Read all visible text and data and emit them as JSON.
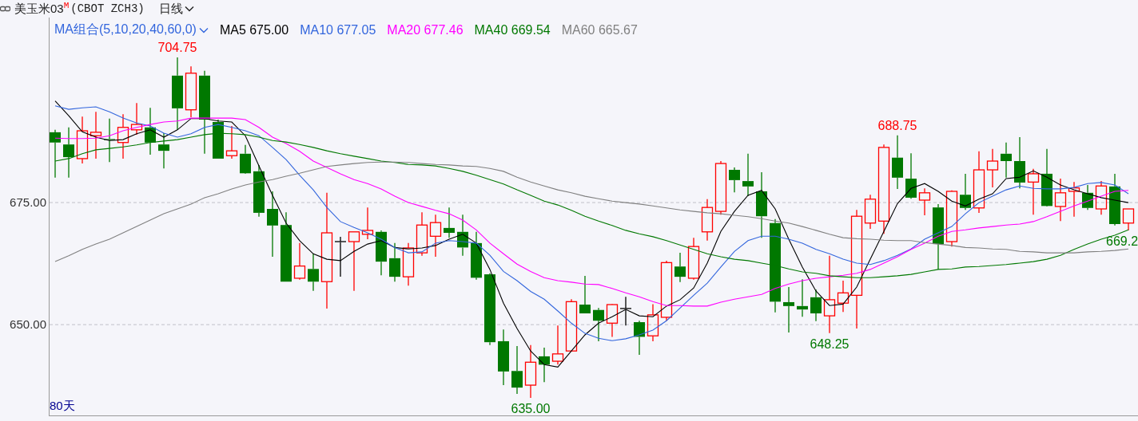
{
  "header": {
    "title": "美玉米03",
    "badge": "M",
    "code": "(CBOT ZCH3)",
    "period": "日线"
  },
  "legend": {
    "label": "MA组合(5,10,20,40,60,0)",
    "values": [
      "675.00",
      "677.05",
      "677.46",
      "669.54",
      "665.67"
    ]
  },
  "day_count": "80天",
  "chart_data": {
    "type": "candlestick",
    "ylim": [
      631.4,
      712.9
    ],
    "yticks": [
      {
        "value": 650,
        "label": "650.00"
      },
      {
        "value": 675,
        "label": "675.00"
      }
    ],
    "ohlc": [
      [
        689.4,
        689.9,
        680.1,
        687.3
      ],
      [
        686.9,
        690.4,
        680.1,
        684.3
      ],
      [
        684.0,
        692.6,
        683.0,
        689.7
      ],
      [
        688.7,
        693.6,
        684.0,
        689.4
      ],
      [
        688.0,
        692.2,
        683.3,
        687.8
      ],
      [
        687.3,
        693.1,
        684.0,
        690.4
      ],
      [
        689.9,
        695.4,
        688.9,
        691.0
      ],
      [
        690.4,
        694.4,
        684.8,
        687.3
      ],
      [
        686.9,
        689.2,
        682.0,
        685.6
      ],
      [
        701.0,
        704.75,
        689.9,
        694.3
      ],
      [
        694.0,
        702.9,
        692.5,
        701.5
      ],
      [
        701.0,
        702.0,
        685.0,
        692.0
      ],
      [
        691.5,
        692.0,
        684.0,
        684.0
      ],
      [
        684.6,
        690.7,
        684.0,
        685.6
      ],
      [
        685.0,
        686.8,
        680.9,
        681.0
      ],
      [
        681.4,
        682.7,
        672.1,
        672.9
      ],
      [
        673.7,
        677.3,
        663.9,
        670.3
      ],
      [
        670.4,
        673.0,
        658.8,
        658.8
      ],
      [
        659.5,
        666.7,
        659.2,
        662.0
      ],
      [
        661.4,
        664.5,
        656.9,
        658.8
      ],
      [
        658.8,
        677.0,
        653.3,
        668.8
      ],
      [
        667.0,
        668.0,
        659.8,
        667.0
      ],
      [
        667.0,
        669.0,
        656.9,
        669.0
      ],
      [
        668.5,
        674.0,
        667.5,
        669.3
      ],
      [
        669.0,
        669.3,
        660.1,
        662.9
      ],
      [
        663.6,
        666.7,
        658.8,
        659.8
      ],
      [
        659.8,
        666.7,
        658.0,
        665.7
      ],
      [
        664.7,
        673.0,
        664.1,
        670.4
      ],
      [
        668.1,
        672.5,
        663.9,
        670.9
      ],
      [
        669.8,
        674.0,
        667.8,
        668.8
      ],
      [
        669.0,
        672.5,
        664.1,
        665.8
      ],
      [
        666.7,
        669.0,
        659.2,
        659.6
      ],
      [
        660.3,
        660.5,
        645.8,
        646.4
      ],
      [
        646.6,
        649.0,
        637.6,
        640.4
      ],
      [
        640.5,
        645.6,
        635.8,
        637.1
      ],
      [
        637.6,
        645.8,
        635.0,
        642.3
      ],
      [
        643.5,
        645.3,
        638.2,
        641.8
      ],
      [
        642.5,
        649.8,
        641.8,
        644.0
      ],
      [
        644.6,
        655.2,
        644.6,
        654.7
      ],
      [
        654.1,
        660.0,
        652.3,
        652.3
      ],
      [
        653.0,
        653.4,
        646.6,
        650.8
      ],
      [
        650.3,
        654.2,
        647.5,
        654.1
      ],
      [
        653.3,
        655.7,
        649.8,
        653.3
      ],
      [
        650.5,
        650.8,
        643.8,
        647.5
      ],
      [
        647.7,
        654.2,
        646.6,
        652.0
      ],
      [
        651.5,
        663.1,
        650.8,
        662.7
      ],
      [
        661.9,
        664.7,
        658.7,
        659.8
      ],
      [
        659.5,
        667.8,
        659.2,
        666.0
      ],
      [
        669.0,
        675.7,
        667.2,
        674.0
      ],
      [
        673.2,
        683.5,
        672.5,
        683.0
      ],
      [
        681.7,
        682.2,
        677.1,
        679.6
      ],
      [
        679.4,
        685.0,
        676.3,
        678.3
      ],
      [
        677.3,
        681.2,
        667.8,
        672.2
      ],
      [
        670.8,
        671.6,
        652.5,
        654.7
      ],
      [
        654.6,
        657.7,
        648.4,
        653.8
      ],
      [
        653.8,
        659.3,
        651.6,
        653.1
      ],
      [
        655.6,
        657.2,
        650.7,
        652.3
      ],
      [
        651.8,
        664.1,
        648.25,
        655.1
      ],
      [
        654.4,
        659.0,
        652.6,
        656.5
      ],
      [
        656.0,
        673.5,
        649.2,
        672.2
      ],
      [
        670.8,
        676.6,
        669.6,
        675.7
      ],
      [
        671.2,
        686.9,
        668.6,
        686.3
      ],
      [
        684.2,
        688.75,
        677.8,
        680.1
      ],
      [
        679.9,
        685.1,
        675.8,
        676.0
      ],
      [
        675.5,
        677.9,
        672.4,
        677.0
      ],
      [
        674.0,
        674.7,
        661.3,
        666.5
      ],
      [
        667.0,
        677.5,
        666.0,
        677.3
      ],
      [
        676.6,
        680.9,
        673.5,
        673.9
      ],
      [
        673.9,
        685.5,
        672.9,
        681.7
      ],
      [
        681.7,
        686.0,
        678.1,
        683.5
      ],
      [
        685.0,
        687.3,
        680.1,
        683.5
      ],
      [
        683.5,
        688.4,
        677.9,
        679.1
      ],
      [
        679.2,
        681.9,
        672.5,
        680.9
      ],
      [
        680.9,
        686.0,
        674.2,
        674.3
      ],
      [
        674.2,
        679.9,
        671.2,
        677.0
      ],
      [
        677.3,
        679.2,
        672.1,
        678.0
      ],
      [
        677.0,
        678.6,
        673.5,
        673.9
      ],
      [
        673.7,
        679.4,
        672.5,
        678.4
      ],
      [
        678.3,
        680.9,
        670.3,
        670.6
      ],
      [
        670.8,
        673.7,
        669.3,
        673.7
      ]
    ],
    "annotations": [
      "704.75",
      "635.00",
      "648.25",
      "688.75",
      "669.2"
    ]
  },
  "moving_averages": {
    "chart_data": {
      "type": "line",
      "ylim": [
        631.4,
        712.9
      ],
      "series": [
        {
          "name": "MA5",
          "color": "#000000",
          "values": [
            695.8,
            692.8,
            689.5,
            688.4,
            687.7,
            687.9,
            689.1,
            689.9,
            688.4,
            689.9,
            692.2,
            692.2,
            691.7,
            691.5,
            688.7,
            682.5,
            676.5,
            670.8,
            667.2,
            664.5,
            663.4,
            663.1,
            665.0,
            666.5,
            667.2,
            665.8,
            665.5,
            665.7,
            666.2,
            667.5,
            668.5,
            666.7,
            661.3,
            654.4,
            649.2,
            644.6,
            641.8,
            641.3,
            644.6,
            647.9,
            650.3,
            651.6,
            653.1,
            651.8,
            651.6,
            653.8,
            655.1,
            657.5,
            662.6,
            669.1,
            673.2,
            676.5,
            677.5,
            673.7,
            667.5,
            661.8,
            656.9,
            653.9,
            654.2,
            657.7,
            663.4,
            669.1,
            674.8,
            677.9,
            678.9,
            677.3,
            675.3,
            674.3,
            675.7,
            676.8,
            679.9,
            680.2,
            681.5,
            680.2,
            678.6,
            677.6,
            676.8,
            676.0,
            675.5,
            675.0
          ]
        },
        {
          "name": "MA10",
          "color": "#3366dd",
          "values": [
            694.8,
            694.1,
            694.4,
            694.6,
            693.6,
            692.3,
            691.3,
            690.7,
            689.2,
            688.4,
            689.1,
            690.4,
            691.0,
            690.4,
            689.7,
            688.7,
            686.3,
            683.8,
            680.6,
            677.6,
            674.0,
            671.1,
            669.9,
            668.8,
            667.5,
            665.8,
            664.7,
            664.9,
            666.7,
            667.2,
            667.0,
            666.7,
            664.2,
            660.9,
            659.0,
            656.8,
            655.2,
            652.8,
            650.3,
            648.2,
            647.2,
            646.7,
            647.1,
            647.9,
            648.9,
            650.8,
            653.4,
            656.0,
            658.5,
            661.8,
            665.0,
            667.2,
            668.1,
            668.1,
            667.5,
            666.7,
            665.4,
            664.5,
            663.4,
            662.6,
            662.3,
            663.1,
            664.2,
            665.5,
            667.5,
            668.8,
            670.1,
            672.7,
            675.0,
            676.3,
            677.6,
            678.4,
            677.9,
            677.8,
            677.8,
            678.1,
            678.9,
            679.1,
            678.6,
            676.8
          ]
        },
        {
          "name": "MA20",
          "color": "#ff00ff",
          "values": [
            688.2,
            688.1,
            688.1,
            688.2,
            688.7,
            689.7,
            690.4,
            691.0,
            691.5,
            691.7,
            692.3,
            692.3,
            692.3,
            692.3,
            692.0,
            690.4,
            688.4,
            687.1,
            685.5,
            683.5,
            682.2,
            680.9,
            679.7,
            678.9,
            677.8,
            676.3,
            675.0,
            674.2,
            673.4,
            672.7,
            671.4,
            669.4,
            666.7,
            664.5,
            662.4,
            660.9,
            659.6,
            659.0,
            658.7,
            658.3,
            658.2,
            657.4,
            656.5,
            655.7,
            654.7,
            653.9,
            653.9,
            653.8,
            653.8,
            654.6,
            655.2,
            655.7,
            656.2,
            657.4,
            658.3,
            659.0,
            659.5,
            659.8,
            660.1,
            660.5,
            661.3,
            662.6,
            663.9,
            665.4,
            666.7,
            668.1,
            669.1,
            669.4,
            669.8,
            670.1,
            670.4,
            670.6,
            671.1,
            672.1,
            673.2,
            674.3,
            675.3,
            676.3,
            677.3,
            677.5
          ]
        },
        {
          "name": "MA40",
          "color": "#007800",
          "values": [
            683.5,
            684.0,
            685.0,
            685.8,
            686.1,
            686.4,
            686.8,
            687.3,
            687.6,
            687.9,
            688.4,
            688.9,
            689.2,
            689.1,
            688.9,
            688.4,
            687.7,
            687.4,
            686.9,
            686.3,
            685.6,
            685.0,
            684.5,
            684.0,
            683.5,
            683.2,
            682.8,
            682.7,
            682.5,
            682.0,
            681.4,
            680.6,
            679.7,
            678.8,
            677.6,
            676.5,
            675.3,
            674.5,
            673.4,
            672.2,
            671.2,
            670.3,
            669.3,
            668.6,
            668.0,
            667.2,
            666.3,
            665.4,
            664.5,
            663.9,
            663.4,
            663.1,
            662.6,
            662.1,
            661.4,
            660.8,
            660.5,
            660.0,
            659.8,
            659.6,
            659.6,
            659.8,
            660.0,
            660.3,
            660.8,
            661.3,
            661.4,
            661.8,
            661.9,
            662.1,
            662.3,
            662.6,
            662.9,
            663.4,
            664.2,
            665.4,
            666.5,
            667.5,
            668.3,
            669.4
          ]
        },
        {
          "name": "MA60",
          "color": "#808080",
          "values": [
            662.9,
            664.1,
            665.4,
            666.5,
            667.5,
            668.8,
            670.1,
            671.4,
            672.7,
            673.7,
            674.7,
            676.0,
            676.8,
            677.8,
            678.6,
            679.2,
            679.7,
            680.4,
            681.0,
            681.7,
            682.4,
            682.7,
            683.0,
            683.2,
            683.3,
            683.3,
            683.2,
            683.0,
            682.8,
            682.7,
            682.5,
            682.4,
            682.0,
            681.4,
            680.2,
            679.2,
            678.4,
            677.6,
            677.0,
            676.3,
            675.8,
            675.3,
            675.0,
            674.7,
            674.3,
            673.9,
            673.5,
            673.2,
            672.9,
            672.7,
            672.4,
            672.1,
            671.7,
            671.2,
            670.8,
            670.1,
            669.3,
            668.5,
            667.8,
            667.6,
            667.5,
            667.3,
            667.2,
            667.2,
            666.8,
            666.5,
            666.2,
            665.8,
            665.7,
            665.5,
            665.4,
            665.0,
            664.9,
            664.7,
            664.7,
            664.7,
            664.9,
            665.0,
            665.2,
            665.5
          ]
        }
      ]
    }
  }
}
